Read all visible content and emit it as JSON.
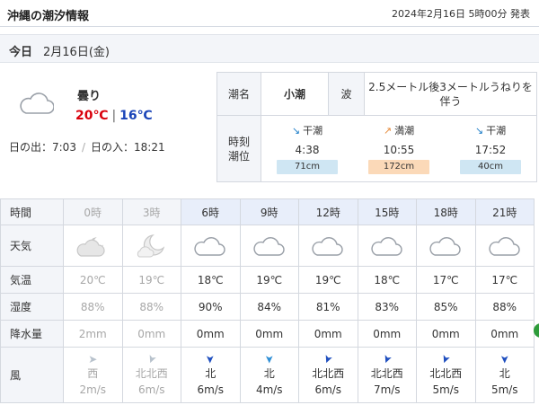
{
  "header": {
    "title": "沖縄の潮汐情報",
    "issued": "2024年2月16日 5時00分 発表"
  },
  "day": {
    "today_label": "今日",
    "date": "2月16日(金)"
  },
  "summary": {
    "weather_icon": "cloud-icon",
    "weather": "曇り",
    "max_temp": "20℃",
    "separator": "|",
    "min_temp": "16℃",
    "sunrise": "日の出：7:03",
    "sunset": "日の入：18:21",
    "colors": {
      "max": "#d9000b",
      "min": "#1a44b8"
    }
  },
  "tide": {
    "tide_label": "潮名",
    "tide_name": "小潮",
    "wave_label": "波",
    "wave_text": "2.5メートル後3メートルうねりを伴う",
    "time_label_1": "時刻",
    "time_label_2": "潮位",
    "entries": [
      {
        "type": "干潮",
        "arrow": "↘",
        "time": "4:38",
        "level": "71cm",
        "fill": 0.71,
        "color": "#cfe6f3"
      },
      {
        "type": "満潮",
        "arrow": "↗",
        "time": "10:55",
        "level": "172cm",
        "fill": 1.0,
        "color": "#fbd9b8"
      },
      {
        "type": "干潮",
        "arrow": "↘",
        "time": "17:52",
        "level": "40cm",
        "fill": 0.4,
        "color": "#cfe6f3"
      }
    ]
  },
  "hourly": {
    "labels": {
      "time": "時間",
      "weather": "天気",
      "temp": "気温",
      "humidity": "湿度",
      "precip": "降水量",
      "wind": "風"
    },
    "columns": [
      {
        "hour": "0時",
        "past": true,
        "icon": "cloudy-night-moon-icon",
        "temp": "20℃",
        "humidity": "88%",
        "precip": "2mm",
        "wind_dir": "西",
        "wind_speed": "2m/s",
        "wind_arrow": "➤",
        "wind_rot": 0
      },
      {
        "hour": "3時",
        "past": true,
        "icon": "moon-cloud-icon",
        "temp": "19℃",
        "humidity": "88%",
        "precip": "0mm",
        "wind_dir": "北北西",
        "wind_speed": "6m/s",
        "wind_arrow": "➤",
        "wind_rot": 112
      },
      {
        "hour": "6時",
        "past": false,
        "icon": "cloud-icon",
        "temp": "18℃",
        "humidity": "90%",
        "precip": "0mm",
        "wind_dir": "北",
        "wind_speed": "6m/s",
        "wind_arrow": "➤",
        "wind_rot": 90
      },
      {
        "hour": "9時",
        "past": false,
        "icon": "cloud-icon",
        "temp": "19℃",
        "humidity": "84%",
        "precip": "0mm",
        "wind_dir": "北",
        "wind_speed": "4m/s",
        "wind_arrow": "➤",
        "wind_rot": 90
      },
      {
        "hour": "12時",
        "past": false,
        "icon": "cloud-icon",
        "temp": "19℃",
        "humidity": "81%",
        "precip": "0mm",
        "wind_dir": "北北西",
        "wind_speed": "6m/s",
        "wind_arrow": "➤",
        "wind_rot": 112
      },
      {
        "hour": "15時",
        "past": false,
        "icon": "cloud-icon",
        "temp": "18℃",
        "humidity": "83%",
        "precip": "0mm",
        "wind_dir": "北北西",
        "wind_speed": "7m/s",
        "wind_arrow": "➤",
        "wind_rot": 112
      },
      {
        "hour": "18時",
        "past": false,
        "icon": "cloud-icon",
        "temp": "17℃",
        "humidity": "85%",
        "precip": "0mm",
        "wind_dir": "北北西",
        "wind_speed": "5m/s",
        "wind_arrow": "➤",
        "wind_rot": 112
      },
      {
        "hour": "21時",
        "past": false,
        "icon": "cloud-icon",
        "temp": "17℃",
        "humidity": "88%",
        "precip": "0mm",
        "wind_dir": "北",
        "wind_speed": "5m/s",
        "wind_arrow": "➤",
        "wind_rot": 90
      }
    ]
  }
}
